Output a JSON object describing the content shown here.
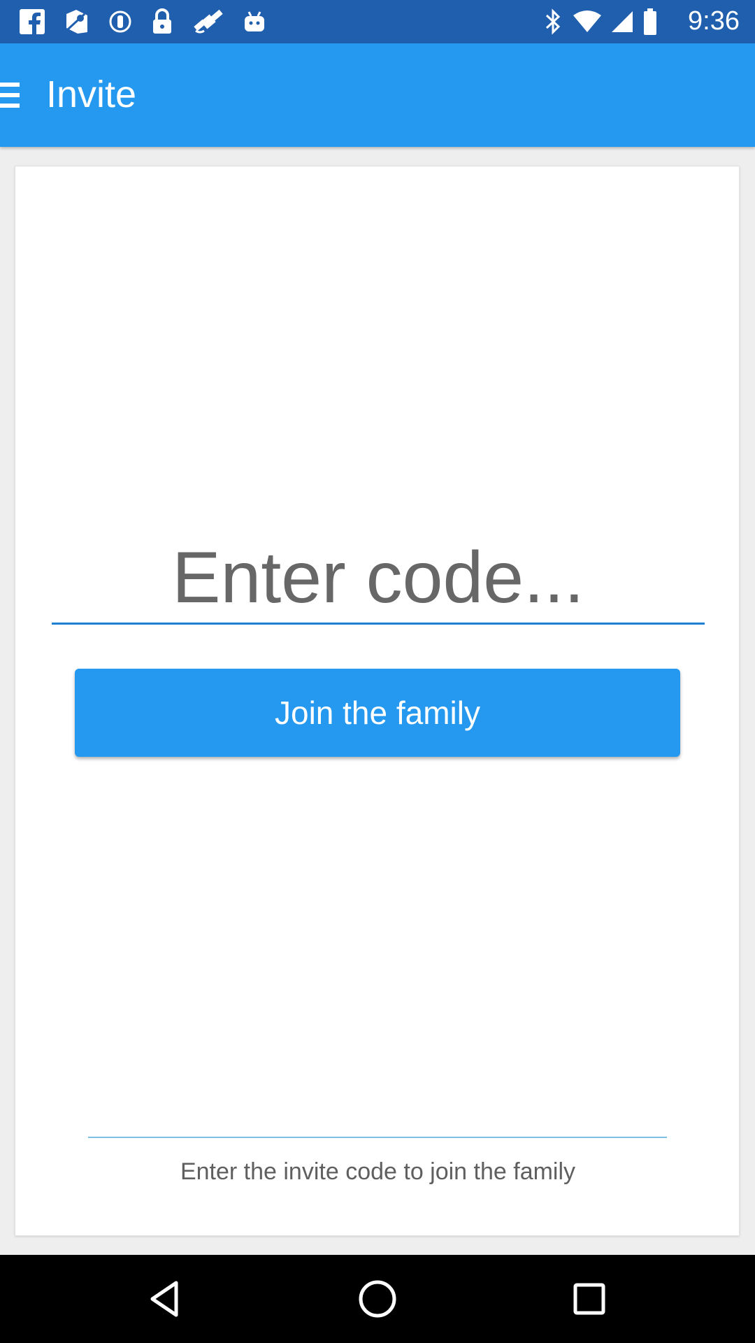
{
  "status_bar": {
    "time": "9:36",
    "icons": [
      "facebook-icon",
      "maps-icon",
      "sim-icon",
      "lock-icon",
      "fake-gps-icon",
      "android-icon",
      "bluetooth-icon",
      "wifi-icon",
      "signal-icon",
      "battery-icon"
    ]
  },
  "app_bar": {
    "title": "Invite",
    "menu_icon": "hamburger-menu-icon"
  },
  "form": {
    "code_placeholder": "Enter code...",
    "code_value": "",
    "join_label": "Join the family",
    "hint": "Enter the invite code to join the family"
  },
  "nav_bar": {
    "icons": [
      "back-icon",
      "home-icon",
      "recents-icon"
    ]
  },
  "colors": {
    "status_bar": "#1f5fae",
    "app_bar": "#2598f0",
    "accent": "#2598f0"
  }
}
